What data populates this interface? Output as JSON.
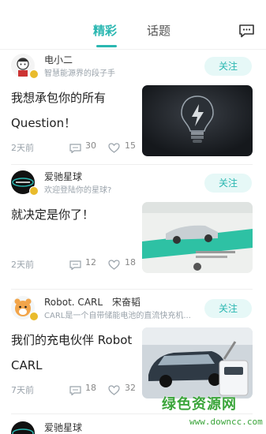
{
  "header": {
    "tabs": [
      {
        "label": "精彩",
        "active": true
      },
      {
        "label": "话题",
        "active": false
      }
    ]
  },
  "accent_color": "#2ab7b1",
  "posts": [
    {
      "username": "电小二",
      "bio": "智慧能源界的段子手",
      "follow_label": "关注",
      "title": "我想承包你的所有 Question！",
      "time": "2天前",
      "comments": "30",
      "likes": "15",
      "thumb": "lightbulb-image"
    },
    {
      "username": "爱驰星球",
      "bio": "欢迎登陆你的星球?",
      "follow_label": "关注",
      "title": "就决定是你了！",
      "time": "2天前",
      "comments": "12",
      "likes": "18",
      "thumb": "ev-poster-image"
    },
    {
      "username": "Robot. CARL　宋奋韬",
      "bio": "CARL是一个自带储能电池的直流快充机...",
      "follow_label": "关注",
      "title": "我们的充电伙伴 Robot CARL",
      "time": "7天前",
      "comments": "18",
      "likes": "32",
      "thumb": "charging-robot-image"
    },
    {
      "username": "爱驰星球"
    }
  ],
  "watermark": {
    "logo": "绿色资源网",
    "url": "www.downcc.com"
  }
}
